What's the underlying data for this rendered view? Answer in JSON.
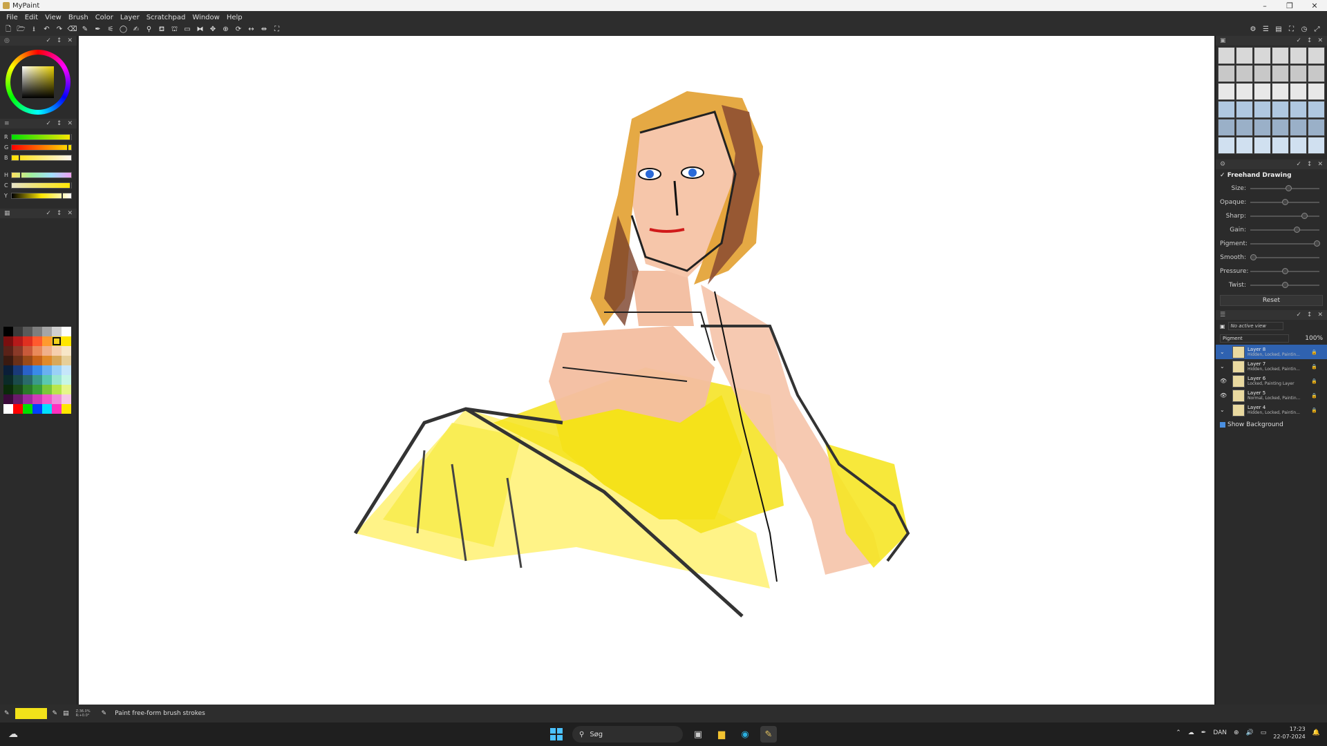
{
  "window": {
    "title": "MyPaint",
    "controls": [
      "–",
      "❐",
      "✕"
    ]
  },
  "menu": [
    "File",
    "Edit",
    "View",
    "Brush",
    "Color",
    "Layer",
    "Scratchpad",
    "Window",
    "Help"
  ],
  "toolbar": {
    "left_icons": [
      "new-icon",
      "open-icon",
      "save-icon",
      "undo-icon",
      "redo-icon",
      "eraser-icon",
      "freehand-icon",
      "inking-icon",
      "lasso-icon",
      "ellipse-icon",
      "bezier-icon",
      "eyedropper-icon",
      "fill-icon",
      "stamp-icon",
      "frame-icon",
      "symmetry-icon",
      "pan-icon",
      "zoom-icon",
      "rotate-icon",
      "flip-icon",
      "mirror-icon",
      "fit-icon"
    ],
    "left_glyphs": [
      "🗋",
      "🗁",
      "⭳",
      "↶",
      "↷",
      "⌫",
      "✎",
      "✒",
      "⚟",
      "◯",
      "✍",
      "⚲",
      "⛾",
      "⛫",
      "▭",
      "⧓",
      "✥",
      "⊕",
      "⟳",
      "↔",
      "⇹",
      "⛶"
    ],
    "right_glyphs": [
      "⚙",
      "☰",
      "▤",
      "⛶",
      "◷",
      "⤢"
    ]
  },
  "left_panel": {
    "rgb_labels": [
      "R",
      "G",
      "B"
    ],
    "hcy_labels": [
      "H",
      "C",
      "Y"
    ],
    "palette": [
      "#000000",
      "#3a3a3a",
      "#5a5a5a",
      "#7e7e7e",
      "#a6a6a6",
      "#d0d0d0",
      "#ffffff",
      "#7a0f0f",
      "#b51a1a",
      "#e03020",
      "#ff5a2e",
      "#ff9a2e",
      "#f2d21a",
      "#ffe600",
      "#5a2218",
      "#8a3a28",
      "#c85a3a",
      "#e98a5a",
      "#f0b08a",
      "#f6cfae",
      "#f7e6c8",
      "#3a1a10",
      "#6a3018",
      "#9a4a18",
      "#c8641a",
      "#e08a2a",
      "#d8a85a",
      "#e6cf9a",
      "#0a1e38",
      "#1a3a78",
      "#2a62c8",
      "#3a8ae8",
      "#6ab0f0",
      "#9ad0f6",
      "#c6e6fa",
      "#0a2a28",
      "#1a4a4a",
      "#2a6a6a",
      "#3a9a8a",
      "#5ac8b0",
      "#9ae6d0",
      "#c6f6e6",
      "#0a2a0a",
      "#1a4a1a",
      "#2a7a2a",
      "#3aa03a",
      "#7ac83a",
      "#b8e64a",
      "#e6f68a",
      "#3a0a3a",
      "#6a1a6a",
      "#a02aa0",
      "#d03ab8",
      "#f05ac8",
      "#f08ad8",
      "#f6c6e6",
      "#ffffff",
      "#ff0000",
      "#00e000",
      "#0040ff",
      "#00e0ff",
      "#ff30c0",
      "#ffe600"
    ],
    "selected_palette_index": 12
  },
  "brush_settings": {
    "title": "Freehand Drawing",
    "rows": [
      {
        "label": "Size:",
        "value": 0.55
      },
      {
        "label": "Opaque:",
        "value": 0.5
      },
      {
        "label": "Sharp:",
        "value": 0.8
      },
      {
        "label": "Gain:",
        "value": 0.68
      },
      {
        "label": "Pigment:",
        "value": 1.0
      },
      {
        "label": "Smooth:",
        "value": 0.0
      },
      {
        "label": "Pressure:",
        "value": 0.5
      },
      {
        "label": "Twist:",
        "value": 0.5
      }
    ],
    "reset_label": "Reset"
  },
  "layers": {
    "view_label": "No active view",
    "mode_label": "Pigment",
    "opacity": "100%",
    "rows": [
      {
        "name": "Layer 8",
        "status": "Hidden, Locked, Paintin...",
        "eye": "⌄"
      },
      {
        "name": "Layer 7",
        "status": "Hidden, Locked, Paintin...",
        "eye": "⌄"
      },
      {
        "name": "Layer 6",
        "status": "Locked, Painting Layer",
        "eye": "👁"
      },
      {
        "name": "Layer 5",
        "status": "Normal, Locked, Paintin...",
        "eye": "👁"
      },
      {
        "name": "Layer 4",
        "status": "Hidden, Locked, Paintin...",
        "eye": "⌄"
      }
    ],
    "show_background_label": "Show Background"
  },
  "status": {
    "color": "#f2e21a",
    "zoom_line1": "Z:36.0%",
    "zoom_line2": "R:+0.0°",
    "hint": "Paint free-form brush strokes"
  },
  "taskbar": {
    "search_label": "Søg",
    "lang": "DAN",
    "time": "17:23",
    "date": "22-07-2024"
  }
}
